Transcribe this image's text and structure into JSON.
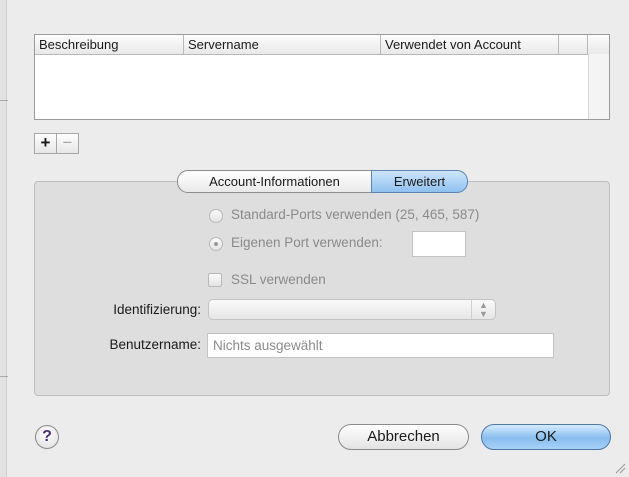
{
  "table": {
    "columns": [
      "Beschreibung",
      "Servername",
      "Verwendet von Account"
    ]
  },
  "list_buttons": {
    "add": "+",
    "remove": "−"
  },
  "tabs": [
    {
      "label": "Account-Informationen",
      "selected": false
    },
    {
      "label": "Erweitert",
      "selected": true
    }
  ],
  "ports": {
    "standard_label": "Standard-Ports verwenden (25, 465, 587)",
    "custom_label": "Eigenen Port verwenden:",
    "custom_value": ""
  },
  "ssl": {
    "label": "SSL verwenden",
    "checked": false
  },
  "auth": {
    "label": "Identifizierung:",
    "value": ""
  },
  "username": {
    "label": "Benutzername:",
    "placeholder": "Nichts ausgewählt"
  },
  "buttons": {
    "help": "?",
    "cancel": "Abbrechen",
    "ok": "OK"
  },
  "colors": {
    "accent": "#88bdee",
    "background": "#ececec"
  }
}
